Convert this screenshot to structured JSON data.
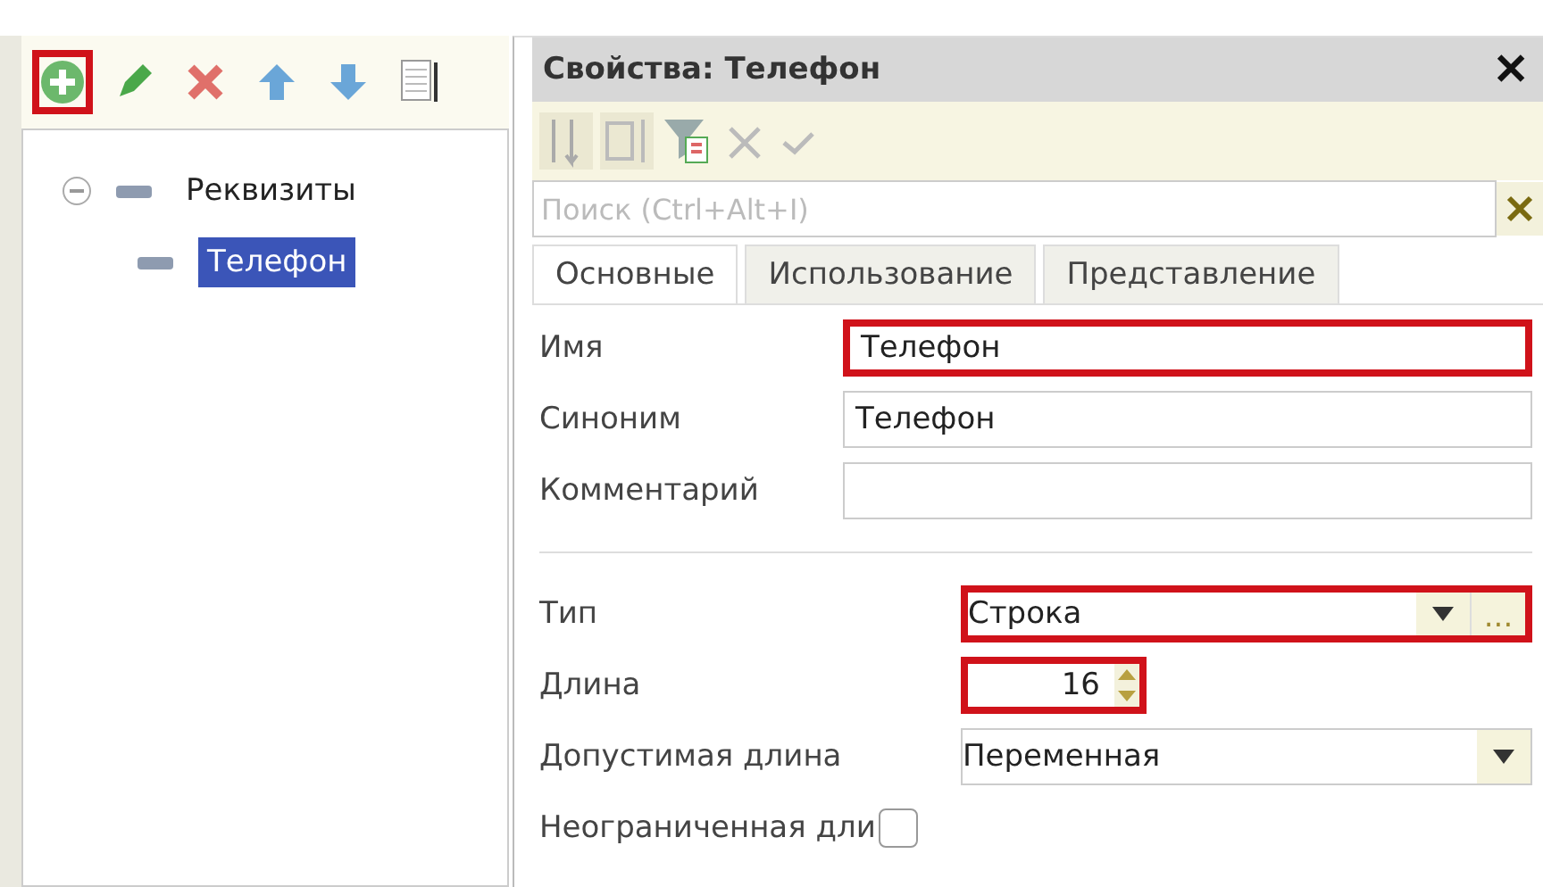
{
  "left_panel": {
    "toolbar": [
      {
        "kind": "add",
        "highlighted": true
      },
      {
        "kind": "edit",
        "highlighted": false
      },
      {
        "kind": "delete",
        "highlighted": false
      },
      {
        "kind": "up",
        "highlighted": false
      },
      {
        "kind": "down",
        "highlighted": false
      },
      {
        "kind": "list",
        "highlighted": false
      }
    ],
    "tree": [
      {
        "label": "Реквизиты",
        "expanded": true,
        "selected": false,
        "children": [
          {
            "label": "Телефон",
            "selected": true
          }
        ]
      }
    ]
  },
  "properties": {
    "title": "Свойства: Телефон",
    "close": "✕",
    "search": {
      "placeholder": "Поиск (Ctrl+Alt+I)"
    },
    "tabs": [
      {
        "label": "Основные",
        "selected": true
      },
      {
        "label": "Использование",
        "selected": false
      },
      {
        "label": "Представление",
        "selected": false
      }
    ],
    "fields": [
      {
        "kind": "text",
        "label": "Имя",
        "value": "Телефон",
        "highlighted": true
      },
      {
        "kind": "text",
        "label": "Синоним",
        "value": "Телефон",
        "highlighted": false
      },
      {
        "kind": "text",
        "label": "Комментарий",
        "highlighted": false
      },
      {
        "kind": "separator"
      },
      {
        "kind": "type",
        "label": "Тип",
        "value": "Строка",
        "button": "...",
        "highlighted": true
      },
      {
        "kind": "spin",
        "label": "Длина",
        "value": "16",
        "highlighted": true
      },
      {
        "kind": "select",
        "label": "Допустимая длина",
        "value": "Переменная",
        "highlighted": false
      },
      {
        "kind": "checkbox",
        "label": "Неограниченная дли",
        "checked": false
      }
    ]
  }
}
